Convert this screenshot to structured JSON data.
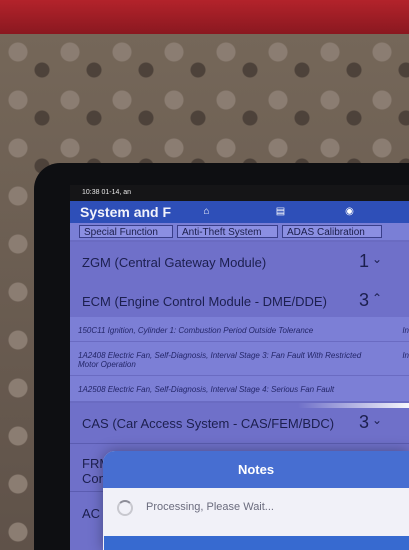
{
  "status_bar": {
    "text": "10:38  01-14, an"
  },
  "header": {
    "title": "System and F"
  },
  "tabs": [
    "Special Function",
    "Anti-Theft System",
    "ADAS Calibration"
  ],
  "modules": [
    {
      "label": "ZGM (Central Gateway Module)",
      "count": "1",
      "chevron": "⌄"
    },
    {
      "label": "ECM (Engine Control Module - DME/DDE)",
      "count": "3",
      "chevron": "⌃"
    },
    {
      "label": "CAS (Car Access System - CAS/FEM/BDC)",
      "count": "3",
      "chevron": "⌄"
    },
    {
      "label": "FRM (",
      "label2": "Contre"
    },
    {
      "label": "AC (A"
    }
  ],
  "faults": [
    {
      "text": "150C11 Ignition, Cylinder 1: Combustion Period Outside Tolerance",
      "right": "In"
    },
    {
      "text": "1A2408 Electric Fan, Self-Diagnosis, Interval Stage 3: Fan Fault With Restricted Motor Operation",
      "right": "In"
    },
    {
      "text": "1A2508 Electric Fan, Self-Diagnosis, Interval Stage 4: Serious Fan Fault",
      "right": ""
    }
  ],
  "modal": {
    "title": "Notes",
    "message": "Processing, Please Wait..."
  }
}
